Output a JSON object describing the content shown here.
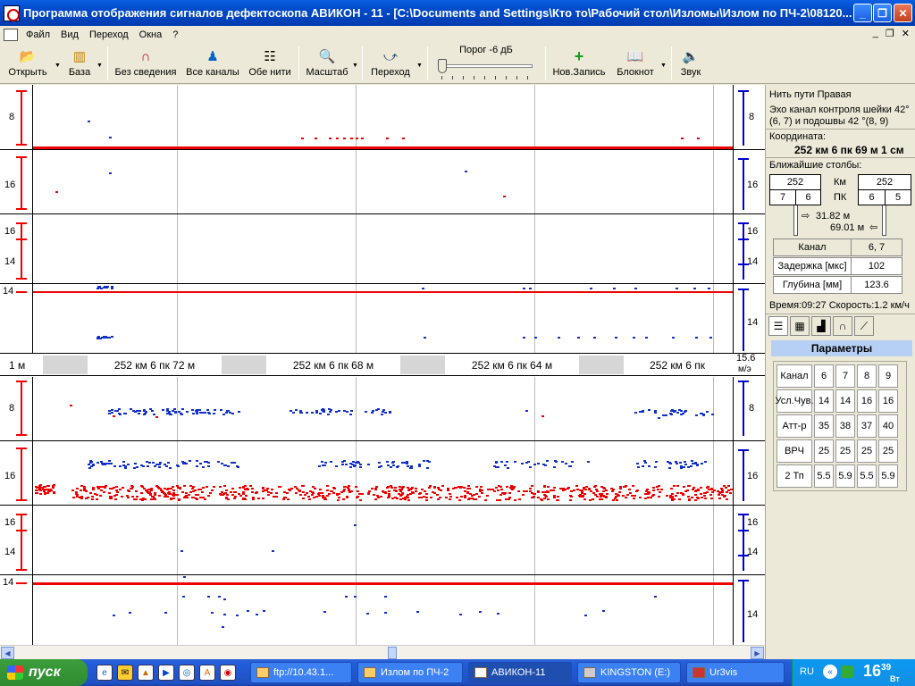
{
  "window": {
    "title": "Программа отображения сигналов дефектоскопа АВИКОН - 11 - [C:\\Documents and Settings\\Кто то\\Рабочий стол\\Изломы\\Излом по ПЧ-2\\08120..."
  },
  "menu": {
    "items": [
      "Файл",
      "Вид",
      "Переход",
      "Окна",
      "?"
    ]
  },
  "toolbar": {
    "open": "Открыть",
    "base": "База",
    "no_reduction": "Без сведения",
    "all_channels": "Все каналы",
    "both_rails": "Обе нити",
    "scale": "Масштаб",
    "goto": "Переход",
    "threshold": "Порог -6 дБ",
    "threshold_db": -6,
    "new_record": "Нов.Запись",
    "notebook": "Блокнот",
    "sound": "Звук"
  },
  "scan": {
    "top": {
      "labels_left": [
        "8",
        "16",
        "16",
        "14",
        "14"
      ],
      "labels_right": [
        "8",
        "16",
        "16",
        "14",
        "14"
      ]
    },
    "bottom": {
      "labels_left": [
        "8",
        "16",
        "16",
        "14",
        "14"
      ],
      "labels_right": [
        "8",
        "16",
        "16",
        "14",
        "14"
      ]
    },
    "ruler": {
      "left": "1 м",
      "marks": [
        "252 км 6 пк 72 м",
        "252 км 6 пк 68 м",
        "252 км 6 пк 64 м",
        "252 км 6 пк"
      ],
      "right_top": "15.6",
      "right_bottom": "м/э"
    }
  },
  "panel": {
    "rail": "Нить пути Правая",
    "channel_desc_1": "Эхо канал контроля шейки 42°",
    "channel_desc_2": "(6, 7) и подошвы 42 °(8, 9)",
    "coord_label": "Координата:",
    "coord_value": "252 км 6 пк 69 м 1 см",
    "posts_label": "Ближайшие столбы:",
    "km_label": "Км",
    "pk_label": "ПК",
    "left_km": "252",
    "left_pk_a": "7",
    "left_pk_b": "6",
    "right_km": "252",
    "right_pk_a": "6",
    "right_pk_b": "5",
    "dist_forward": "31.82 м",
    "dist_back": "69.01 м",
    "channel_label": "Канал",
    "channel_value": "6, 7",
    "delay_label": "Задержка [мкс]",
    "delay_value": "102",
    "depth_label": "Глубина [мм]",
    "depth_value": "123.6",
    "time_speed": "Время:09:27 Скорость:1.2 км/ч",
    "params_title": "Параметры",
    "params_table": {
      "header": [
        "Канал",
        "6",
        "7",
        "8",
        "9"
      ],
      "rows": [
        [
          "Усл.Чув.",
          "14",
          "14",
          "16",
          "16"
        ],
        [
          "Атт-р",
          "35",
          "38",
          "37",
          "40"
        ],
        [
          "ВРЧ",
          "25",
          "25",
          "25",
          "25"
        ],
        [
          "2 Тп",
          "5.5",
          "5.9",
          "5.5",
          "5.9"
        ]
      ]
    }
  },
  "taskbar": {
    "start": "пуск",
    "tasks": [
      "ftp://10.43.1...",
      "Излом по ПЧ-2",
      "АВИКОН-11",
      "KINGSTON (E:)",
      "Ur3vis"
    ],
    "lang": "RU",
    "clock_h": "16",
    "clock_m": "39",
    "clock_day": "Вт"
  }
}
